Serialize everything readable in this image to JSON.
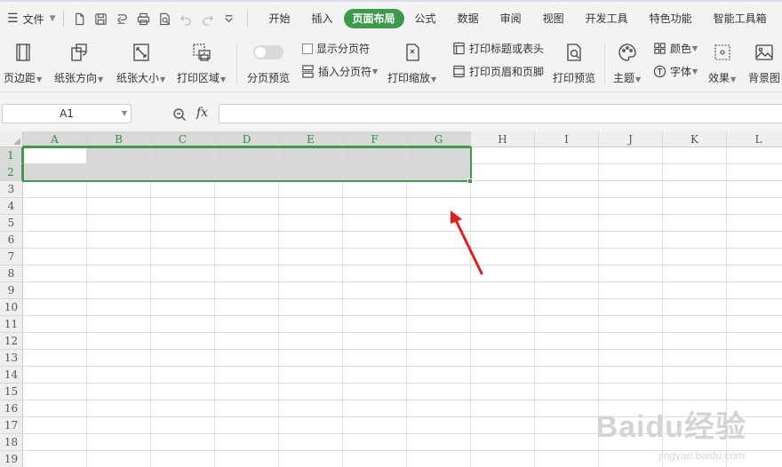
{
  "menubar": {
    "file_label": "文件",
    "tabs": [
      "开始",
      "插入",
      "页面布局",
      "公式",
      "数据",
      "审阅",
      "视图",
      "开发工具",
      "特色功能",
      "智能工具箱"
    ],
    "active_tab_index": 2
  },
  "ribbon": {
    "margins": "页边距",
    "orientation": "纸张方向",
    "size": "纸张大小",
    "print_area": "打印区域",
    "page_break_preview": "分页预览",
    "show_page_breaks": "显示分页符",
    "insert_page_break": "插入分页符",
    "print_scaling": "打印缩放",
    "print_titles": "打印标题或表头",
    "header_footer": "打印页眉和页脚",
    "print_preview": "打印预览",
    "theme": "主题",
    "colors": "颜色",
    "fonts": "字体",
    "effects": "效果",
    "background": "背景图"
  },
  "formula_bar": {
    "name_box": "A1",
    "fx_label": "fx",
    "formula": ""
  },
  "sheet": {
    "columns": [
      "A",
      "B",
      "C",
      "D",
      "E",
      "F",
      "G",
      "H",
      "I",
      "J",
      "K",
      "L"
    ],
    "rows": [
      "1",
      "2",
      "3",
      "4",
      "5",
      "6",
      "7",
      "8",
      "9",
      "10",
      "11",
      "12",
      "13",
      "14",
      "15",
      "16",
      "17",
      "18",
      "19"
    ],
    "selected_range": "A1:G2",
    "selected_cols": 7,
    "selected_rows": 2
  },
  "colors": {
    "accent": "#3d9a4c",
    "selection_fill": "#d7d7d7",
    "annotation_arrow": "#e02020"
  },
  "watermark": {
    "text": "Baidu经验",
    "sub": "jingyan.baidu.com"
  }
}
